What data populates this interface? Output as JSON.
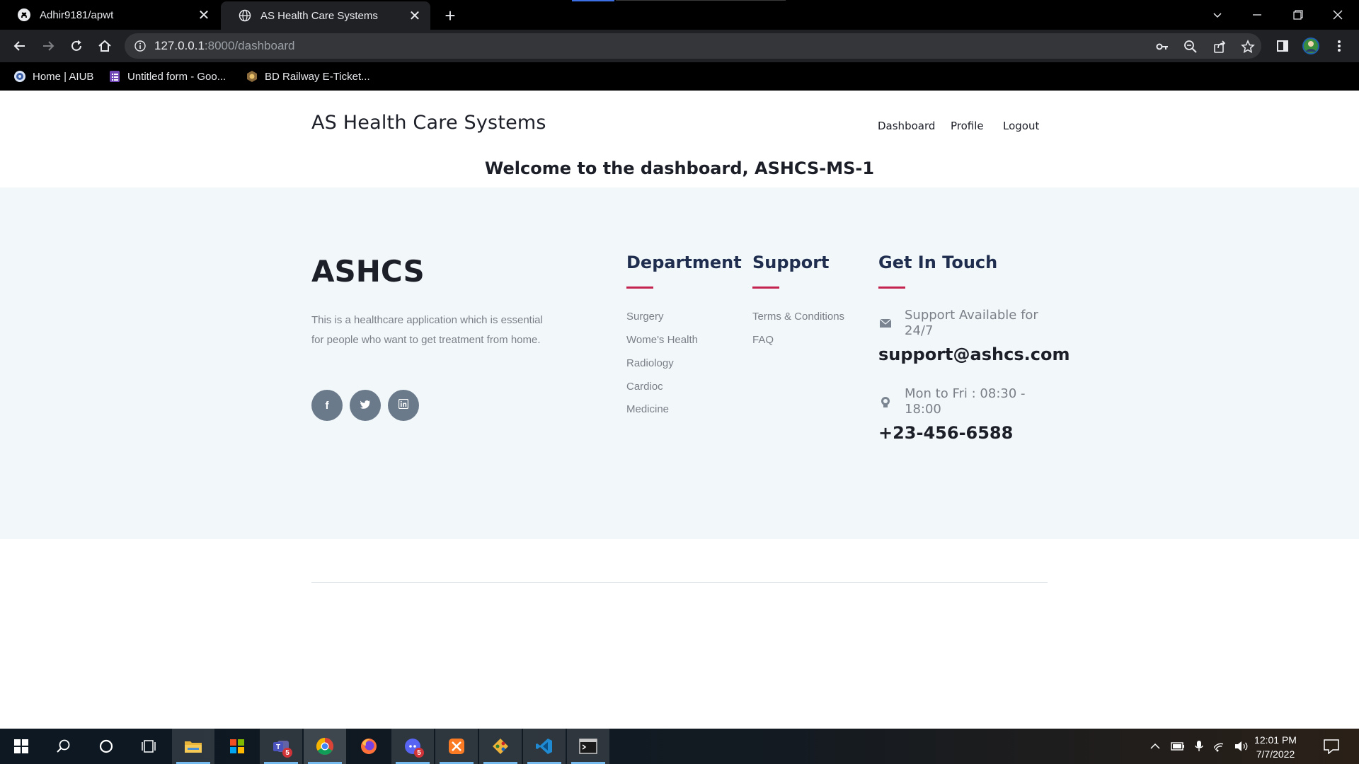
{
  "browser": {
    "tabs": [
      {
        "title": "Adhir9181/apwt",
        "icon": "github-icon"
      },
      {
        "title": "AS Health Care Systems",
        "icon": "globe-icon"
      }
    ],
    "url_host": "127.0.0.1",
    "url_path": ":8000/dashboard",
    "bookmarks": [
      {
        "label": "Home | AIUB",
        "icon": "aiub-icon"
      },
      {
        "label": "Untitled form - Goo...",
        "icon": "google-forms-icon"
      },
      {
        "label": "BD Railway E-Ticket...",
        "icon": "railway-icon"
      }
    ]
  },
  "site": {
    "brand": "AS Health Care Systems",
    "nav": [
      "Dashboard",
      "Profile",
      "Logout"
    ],
    "welcome": "Welcome to the dashboard, ASHCS-MS-1"
  },
  "footer": {
    "logo": "ASHCS",
    "description": "This is a healthcare application which is essential for people who want to get treatment from home.",
    "social": [
      {
        "label": "f",
        "icon": "facebook-icon"
      },
      {
        "label": "t",
        "icon": "twitter-icon"
      },
      {
        "label": "in",
        "icon": "linkedin-icon"
      }
    ],
    "department": {
      "title": "Department",
      "links": [
        "Surgery",
        "Wome's Health",
        "Radiology",
        "Cardioc",
        "Medicine"
      ]
    },
    "support": {
      "title": "Support",
      "links": [
        "Terms & Conditions",
        "FAQ"
      ]
    },
    "contact": {
      "title": "Get In Touch",
      "support_label": "Support Available for 24/7",
      "email": "support@ashcs.com",
      "hours_label": "Mon to Fri : 08:30 - 18:00",
      "phone": "+23-456-6588"
    }
  },
  "taskbar": {
    "apps": [
      "start",
      "search",
      "cortana",
      "task-view",
      "file-explorer",
      "microsoft-store",
      "teams",
      "chrome",
      "firefox",
      "discord",
      "xampp",
      "git",
      "vscode",
      "terminal"
    ],
    "teams_badge": "5",
    "discord_badge": "5",
    "time": "12:01 PM",
    "date": "7/7/2022"
  },
  "colors": {
    "accent_underline": "#c4224f",
    "column_title": "#1f2d4e",
    "footer_bg": "#f2f7fa"
  }
}
